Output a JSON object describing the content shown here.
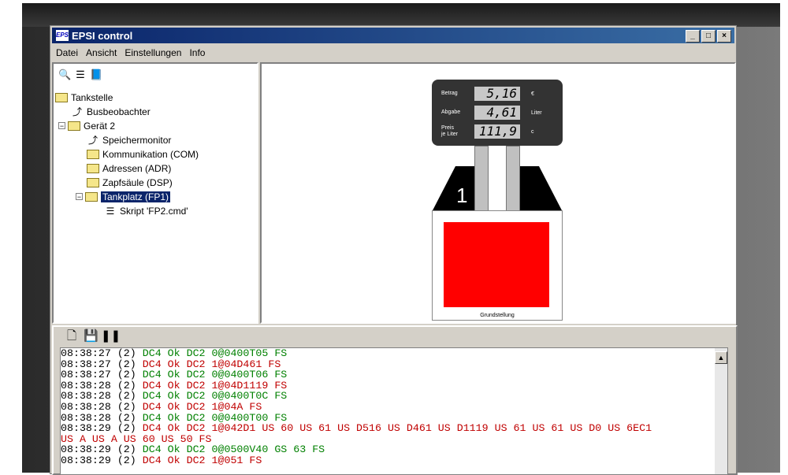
{
  "window": {
    "title": "EPSI control",
    "app_icon": "epsi-logo-icon"
  },
  "menu": {
    "items": [
      "Datei",
      "Ansicht",
      "Einstellungen",
      "Info"
    ]
  },
  "tree": {
    "root": "Tankstelle",
    "busbeobachter": "Busbeobachter",
    "geraet": "Gerät 2",
    "speichermonitor": "Speichermonitor",
    "kommunikation": "Kommunikation (COM)",
    "adressen": "Adressen (ADR)",
    "zapfsaeule": "Zapfsäule (DSP)",
    "tankplatz": "Tankplatz (FP1)",
    "skript": "Skript 'FP2.cmd'"
  },
  "pump": {
    "betrag_label": "Betrag",
    "betrag_value": "5,16",
    "betrag_unit": "€",
    "abgabe_label": "Abgabe",
    "abgabe_value": "4,61",
    "abgabe_unit": "Liter",
    "preis_label1": "Preis",
    "preis_label2": "je Liter",
    "preis_value": "111,9",
    "preis_unit": "c",
    "number": "1",
    "status": "Grundstellung"
  },
  "log": [
    {
      "time": "08:38:27 (2)",
      "msg": " DC4 Ok DC2 0@0400T05 FS",
      "color": "green"
    },
    {
      "time": "08:38:27 (2)",
      "msg": " DC4 Ok DC2 1@04D461 FS",
      "color": "red"
    },
    {
      "time": "08:38:27 (2)",
      "msg": " DC4 Ok DC2 0@0400T06 FS",
      "color": "green"
    },
    {
      "time": "08:38:28 (2)",
      "msg": " DC4 Ok DC2 1@04D1119 FS",
      "color": "red"
    },
    {
      "time": "08:38:28 (2)",
      "msg": " DC4 Ok DC2 0@0400T0C FS",
      "color": "green"
    },
    {
      "time": "08:38:28 (2)",
      "msg": " DC4 Ok DC2 1@04A FS",
      "color": "red"
    },
    {
      "time": "08:38:28 (2)",
      "msg": " DC4 Ok DC2 0@0400T00 FS",
      "color": "green"
    },
    {
      "time": "08:38:29 (2)",
      "msg": " DC4 Ok DC2 1@042D1 US 60 US 61 US D516 US D461 US D1119 US 61 US 61 US D0 US 6EC1",
      "color": "red"
    },
    {
      "time": "",
      "msg": "US A US A US 60 US 50 FS",
      "color": "red"
    },
    {
      "time": "08:38:29 (2)",
      "msg": " DC4 Ok DC2 0@0500V40 GS 63 FS",
      "color": "green"
    },
    {
      "time": "08:38:29 (2)",
      "msg": " DC4 Ok DC2 1@051 FS",
      "color": "red"
    }
  ]
}
